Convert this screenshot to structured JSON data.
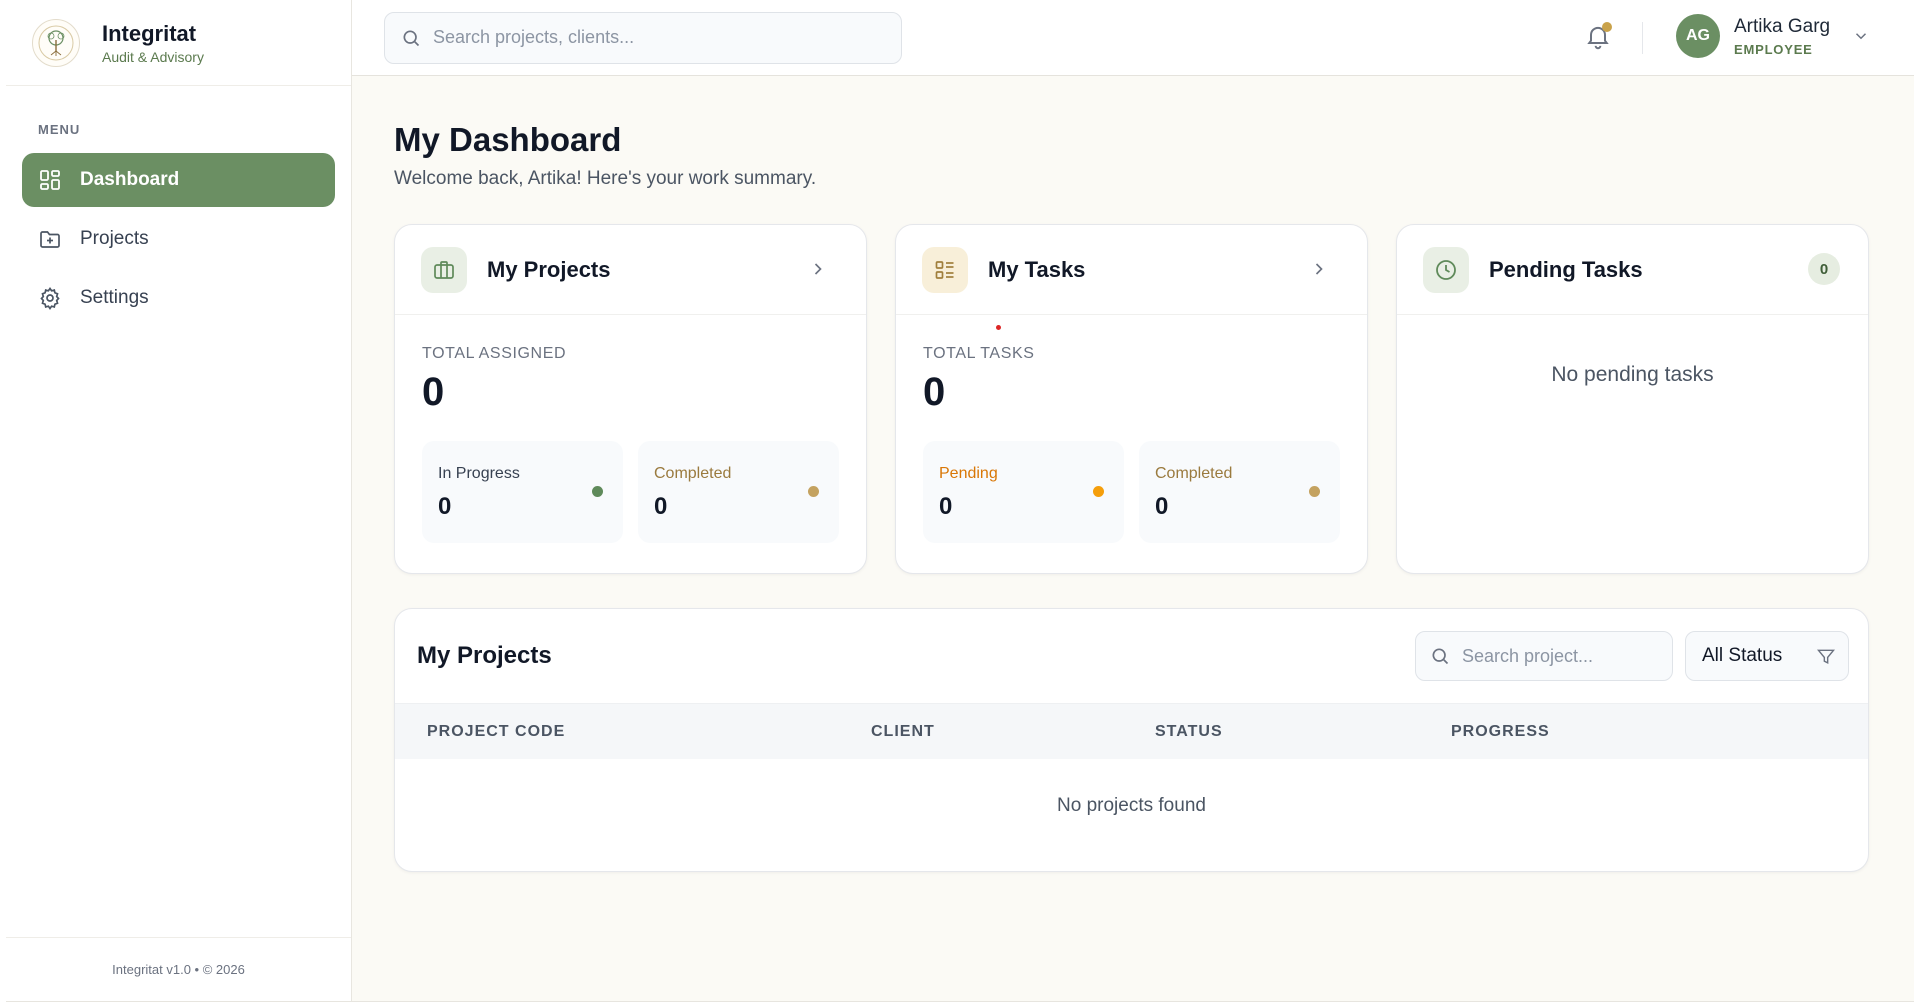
{
  "brand": {
    "name": "Integritat",
    "subtitle": "Audit & Advisory"
  },
  "sidebar": {
    "menu_label": "MENU",
    "items": [
      {
        "label": "Dashboard",
        "icon": "dashboard-grid-icon",
        "active": true
      },
      {
        "label": "Projects",
        "icon": "folder-plus-icon",
        "active": false
      },
      {
        "label": "Settings",
        "icon": "gear-icon",
        "active": false
      }
    ],
    "footer": "Integritat v1.0 • © 2026"
  },
  "topbar": {
    "search_placeholder": "Search projects, clients...",
    "user": {
      "initials": "AG",
      "name": "Artika Garg",
      "role": "EMPLOYEE"
    }
  },
  "page": {
    "title": "My Dashboard",
    "subtitle": "Welcome back, Artika! Here's your work summary."
  },
  "cards": {
    "projects": {
      "title": "My Projects",
      "stat_label": "TOTAL ASSIGNED",
      "stat_value": "0",
      "sub": [
        {
          "label": "In Progress",
          "value": "0",
          "color": "#5f8a5a"
        },
        {
          "label": "Completed",
          "value": "0",
          "color": "#c4a260"
        }
      ]
    },
    "tasks": {
      "title": "My Tasks",
      "stat_label": "TOTAL TASKS",
      "stat_value": "0",
      "sub": [
        {
          "label": "Pending",
          "value": "0",
          "color": "#f59e0b"
        },
        {
          "label": "Completed",
          "value": "0",
          "color": "#c4a260"
        }
      ]
    },
    "pending": {
      "title": "Pending Tasks",
      "count": "0",
      "empty": "No pending tasks"
    }
  },
  "table": {
    "title": "My Projects",
    "search_placeholder": "Search project...",
    "status_filter": "All Status",
    "columns": [
      "PROJECT CODE",
      "CLIENT",
      "STATUS",
      "PROGRESS"
    ],
    "empty": "No projects found"
  },
  "colors": {
    "accent": "#6b8f63",
    "gold": "#c9a24a",
    "background": "#fbfaf5"
  }
}
